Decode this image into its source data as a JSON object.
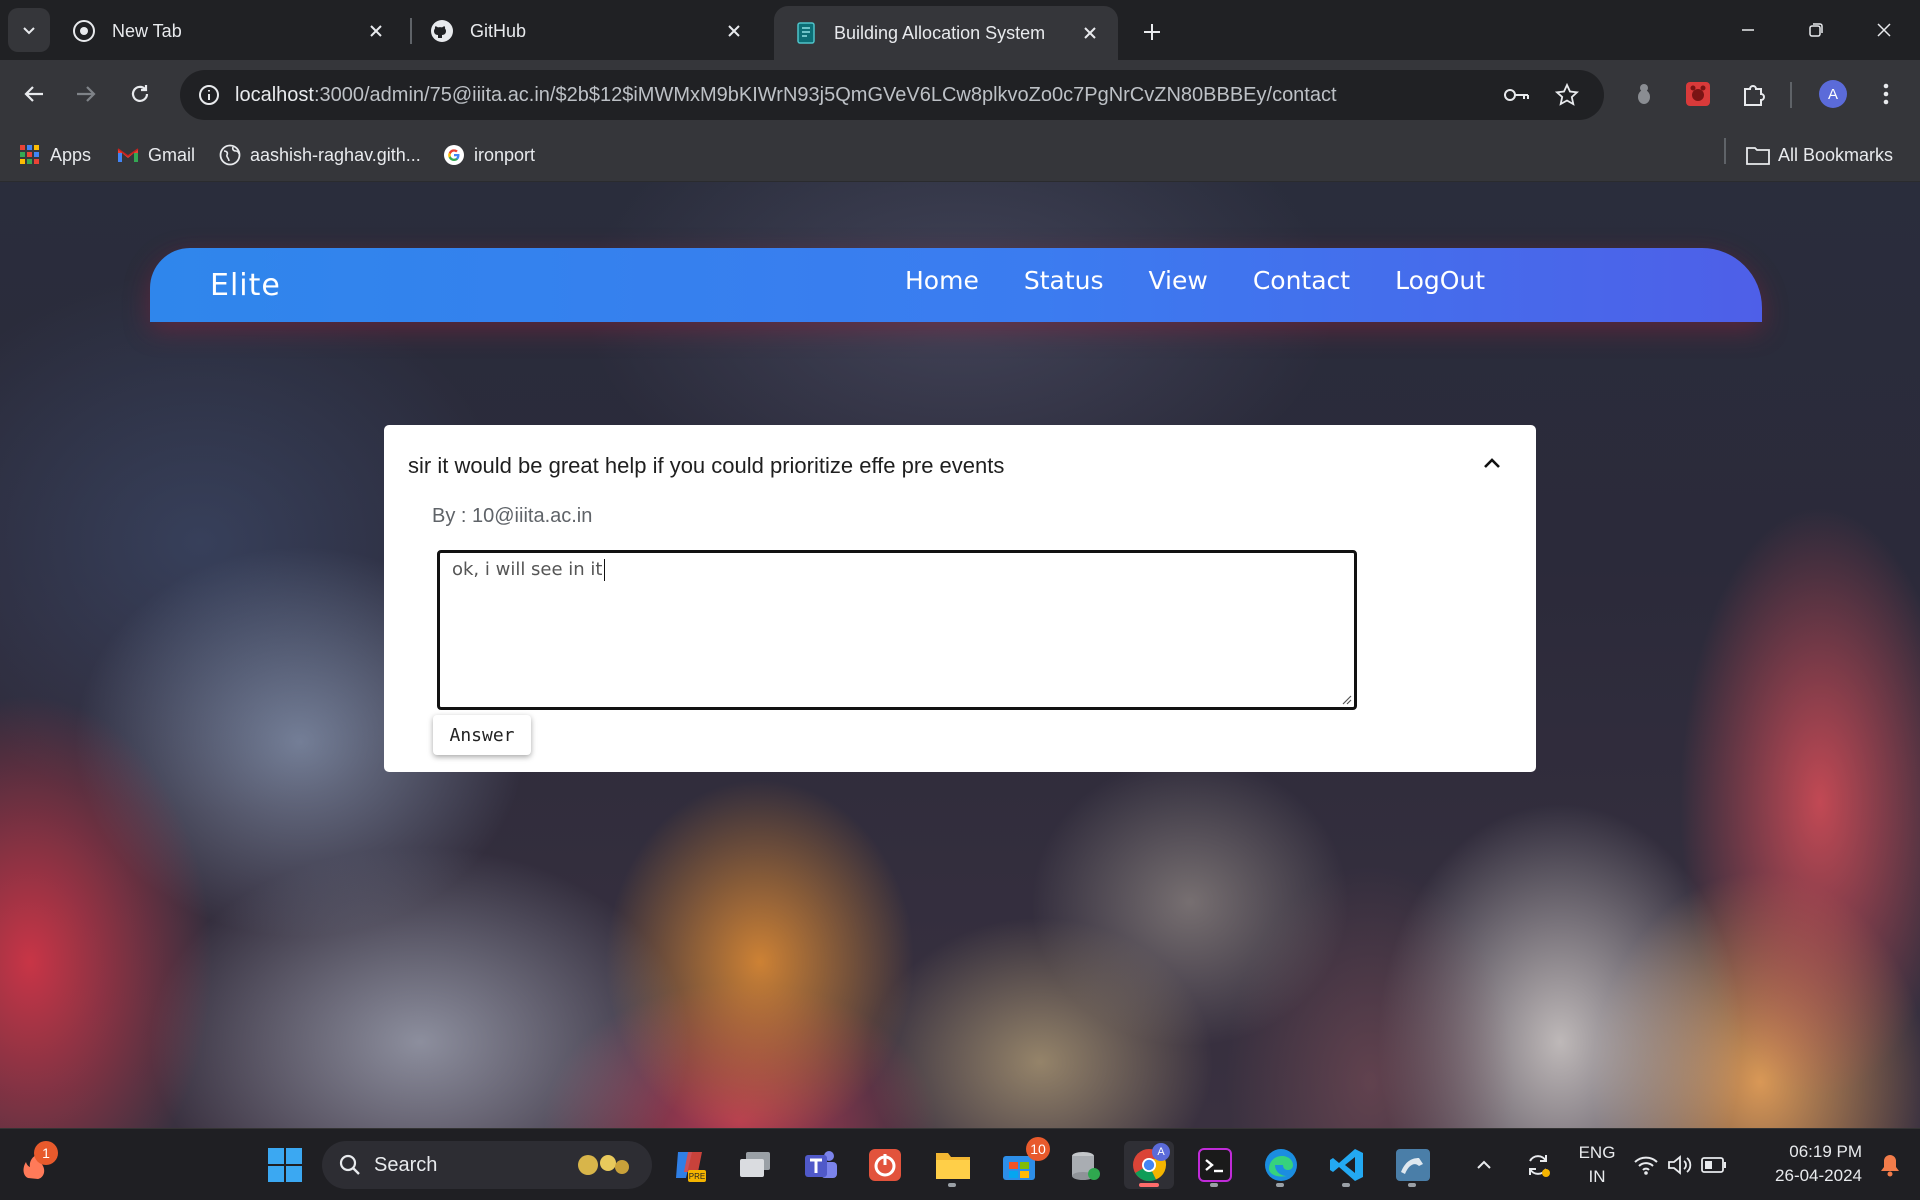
{
  "browser": {
    "tabs": [
      {
        "title": "New Tab",
        "icon": "chrome-icon"
      },
      {
        "title": "GitHub",
        "icon": "github-icon"
      },
      {
        "title": "Building Allocation System",
        "icon": "page-icon",
        "active": true
      }
    ],
    "url_host": "localhost",
    "url_rest": ":3000/admin/75@iiita.ac.in/$2b$12$iMWMxM9bKIWrN93j5QmGVeV6LCw8plkvoZo0c7PgNrCvZN80BBBEy/contact",
    "profile_initial": "A",
    "bookmarks": [
      {
        "label": "Apps",
        "icon": "apps-grid-icon"
      },
      {
        "label": "Gmail",
        "icon": "gmail-icon"
      },
      {
        "label": "aashish-raghav.gith...",
        "icon": "globe-icon"
      },
      {
        "label": "ironport",
        "icon": "google-icon"
      }
    ],
    "all_bookmarks": "All Bookmarks"
  },
  "app": {
    "brand": "Elite",
    "nav": [
      "Home",
      "Status",
      "View",
      "Contact",
      "LogOut"
    ]
  },
  "query": {
    "question": "sir it would be great help if you could prioritize effe pre events",
    "by_label": "By : 10@iiita.ac.in",
    "answer_text": "ok, i will see in it",
    "answer_button": "Answer",
    "expanded": true
  },
  "taskbar": {
    "search_label": "Search",
    "notification_badge": "1",
    "app_badge": "10",
    "lang_line1": "ENG",
    "lang_line2": "IN",
    "time": "06:19 PM",
    "date": "26-04-2024"
  }
}
